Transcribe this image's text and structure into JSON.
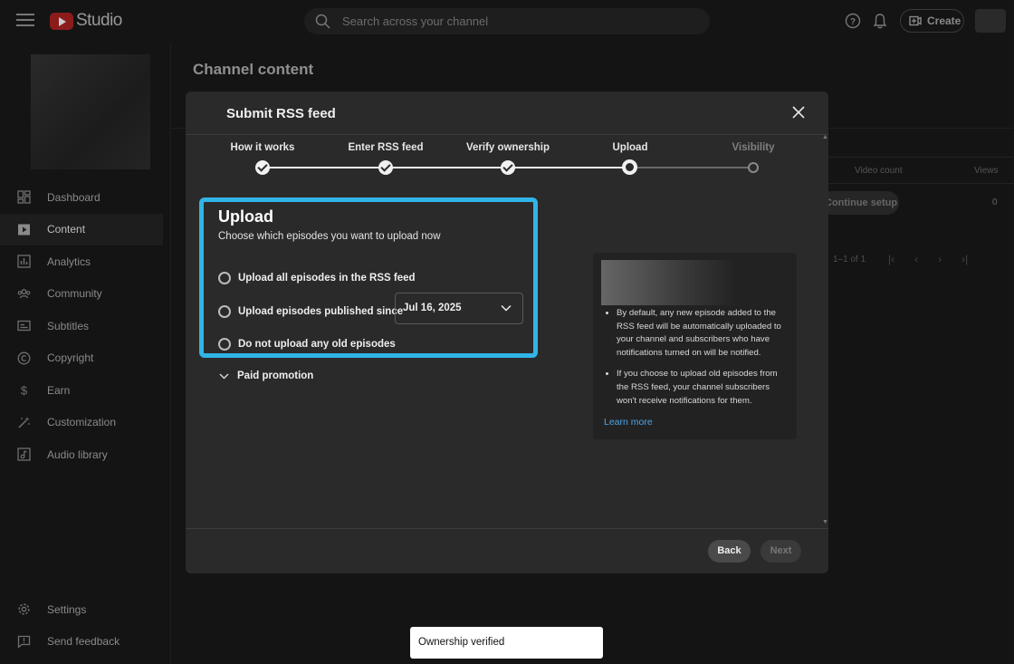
{
  "header": {
    "logo_text": "Studio",
    "search_placeholder": "Search across your channel",
    "create_label": "Create"
  },
  "sidebar": {
    "items": [
      {
        "label": "Dashboard",
        "icon": "dashboard-icon",
        "active": false
      },
      {
        "label": "Content",
        "icon": "content-icon",
        "active": true
      },
      {
        "label": "Analytics",
        "icon": "analytics-icon",
        "active": false
      },
      {
        "label": "Community",
        "icon": "community-icon",
        "active": false
      },
      {
        "label": "Subtitles",
        "icon": "subtitles-icon",
        "active": false
      },
      {
        "label": "Copyright",
        "icon": "copyright-icon",
        "active": false
      },
      {
        "label": "Earn",
        "icon": "earn-icon",
        "active": false
      },
      {
        "label": "Customization",
        "icon": "customization-icon",
        "active": false
      },
      {
        "label": "Audio library",
        "icon": "audio-library-icon",
        "active": false
      }
    ],
    "bottom_items": [
      {
        "label": "Settings",
        "icon": "gear-icon"
      },
      {
        "label": "Send feedback",
        "icon": "feedback-icon"
      }
    ]
  },
  "main": {
    "page_title": "Channel content",
    "table_headers": [
      "Video count",
      "Views"
    ],
    "row_action": "Continue setup",
    "row_views": "0",
    "pager_text": "1–1 of 1"
  },
  "dialog": {
    "title": "Submit RSS feed",
    "steps": [
      {
        "label": "How it works",
        "state": "done"
      },
      {
        "label": "Enter RSS feed",
        "state": "done"
      },
      {
        "label": "Verify ownership",
        "state": "done"
      },
      {
        "label": "Upload",
        "state": "current"
      },
      {
        "label": "Visibility",
        "state": "future"
      }
    ],
    "upload": {
      "title": "Upload",
      "subtitle": "Choose which episodes you want to upload now",
      "options": [
        "Upload all episodes in the RSS feed",
        "Upload episodes published since",
        "Do not upload any old episodes"
      ],
      "date_value": "Jul 16, 2025"
    },
    "paid_promotion_label": "Paid promotion",
    "info": {
      "bullets": [
        "By default, any new episode added to the RSS feed will be automatically uploaded to your channel and subscribers who have notifications turned on will be notified.",
        "If you choose to upload old episodes from the RSS feed, your channel subscribers won't receive notifications for them."
      ],
      "learn_more": "Learn more"
    },
    "back_label": "Back",
    "next_label": "Next"
  },
  "toast": {
    "message": "Ownership verified"
  },
  "colors": {
    "highlight_border": "#31b4e8",
    "link": "#4aa6e8",
    "brand_red": "#8c1c1c"
  }
}
